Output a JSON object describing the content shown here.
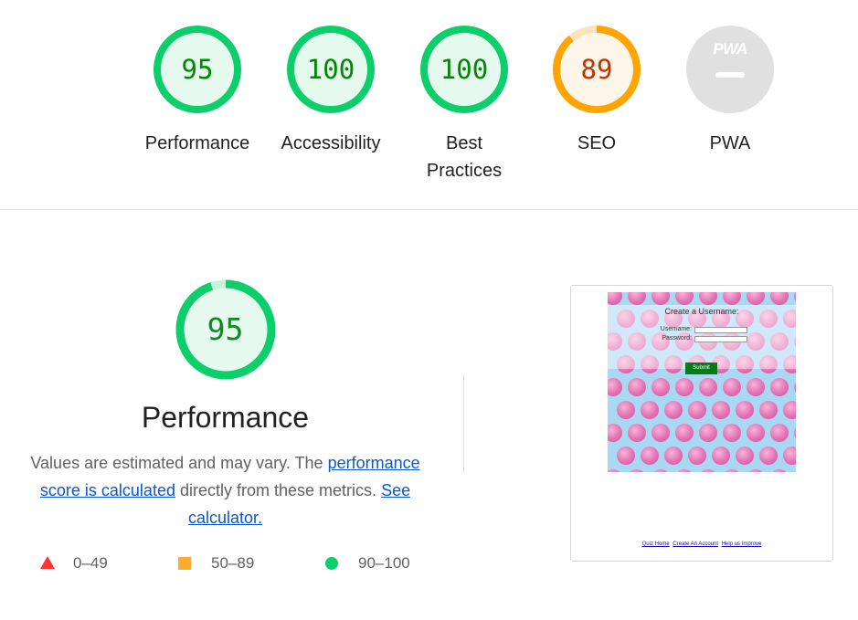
{
  "categories": [
    {
      "id": "performance",
      "score": "95",
      "label": "Performance",
      "status": "pass"
    },
    {
      "id": "accessibility",
      "score": "100",
      "label": "Accessibility",
      "status": "pass"
    },
    {
      "id": "best-practices",
      "score": "100",
      "label": "Best Practices",
      "status": "pass"
    },
    {
      "id": "seo",
      "score": "89",
      "label": "SEO",
      "status": "average"
    },
    {
      "id": "pwa",
      "badge": "PWA",
      "label": "PWA",
      "status": "na"
    }
  ],
  "performance_section": {
    "score": "95",
    "title": "Performance",
    "desc_before": "Values are estimated and may vary. The",
    "link_score": "performance score is calculated",
    "desc_middle": "directly from these metrics.",
    "link_calc": "See calculator."
  },
  "legend": [
    {
      "shape": "triangle-icon",
      "range": "0–49",
      "color": "#ff3333"
    },
    {
      "shape": "square-icon",
      "range": "50–89",
      "color": "#ffaa33"
    },
    {
      "shape": "circle-icon",
      "range": "90–100",
      "color": "#0cce6b"
    }
  ],
  "screenshot_preview": {
    "heading": "Create a Username:",
    "username_label": "Username:",
    "password_label": "Password:",
    "submit_label": "Submit",
    "footer_links": [
      "Quiz Home",
      "Create An Account",
      "Help us Improve"
    ]
  },
  "colors": {
    "pass": "#0cce6b",
    "pass_text": "#008800",
    "pass_fill": "#e6f9ee",
    "average": "#ffa400",
    "average_text": "#c33300",
    "average_fill": "#fff6ea",
    "na": "#e0e0e0"
  }
}
